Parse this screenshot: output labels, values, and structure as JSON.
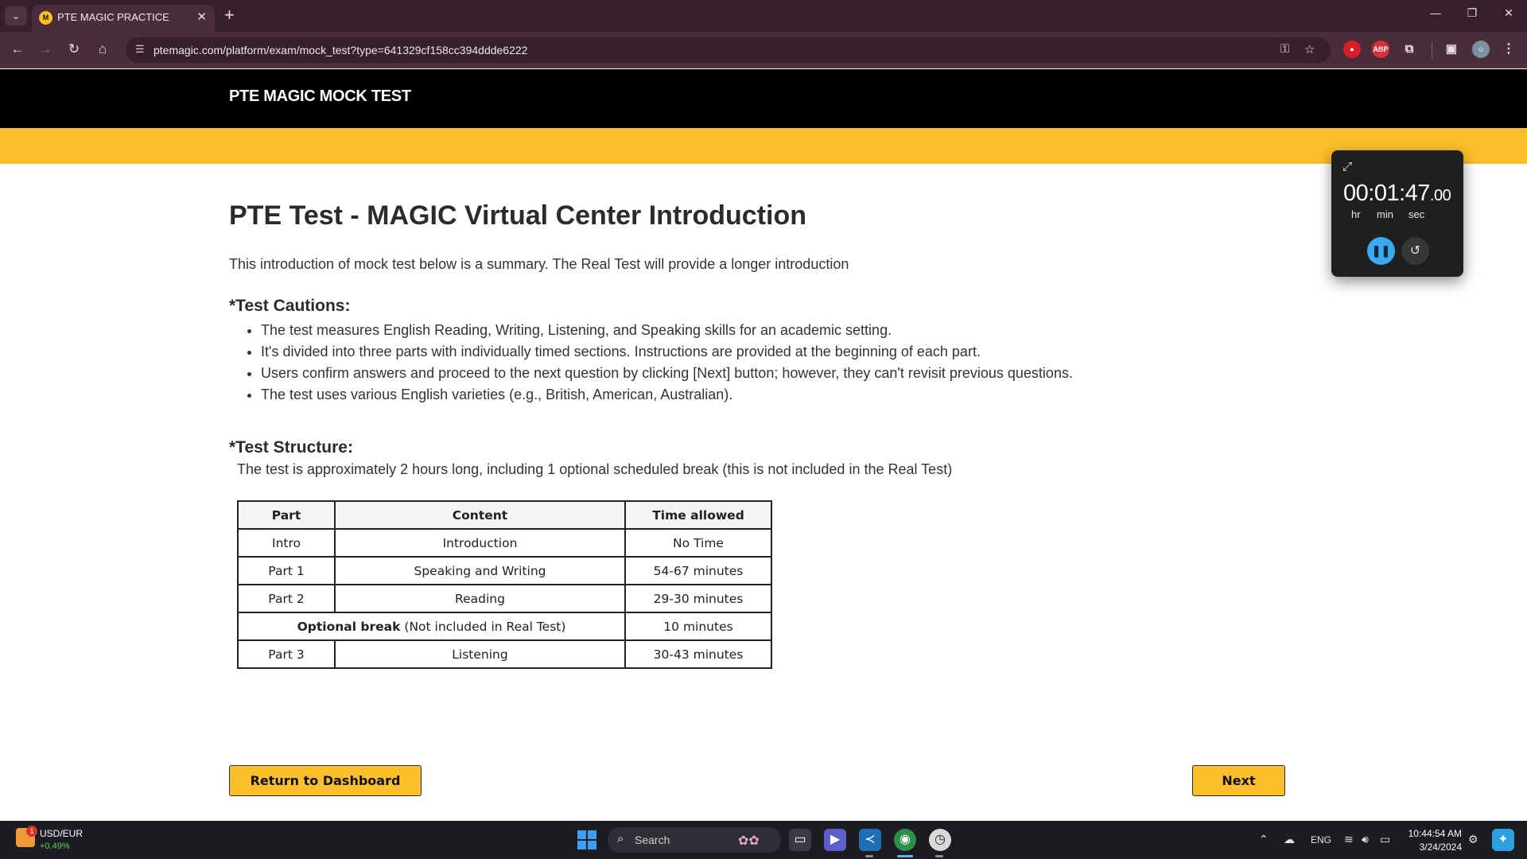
{
  "browser": {
    "tab_title": "PTE MAGIC PRACTICE",
    "tab_favicon_text": "M",
    "new_tab_symbol": "+",
    "close_tab_symbol": "✕",
    "url": "ptemagic.com/platform/exam/mock_test?type=641329cf158cc394ddde6222",
    "extensions": [
      "shield-extension-icon",
      "adblock-icon",
      "puzzle-extensions-icon"
    ],
    "adblock_label": "ABP"
  },
  "header": {
    "logo": "PTE MAGIC MOCK TEST"
  },
  "main": {
    "title": "PTE Test - MAGIC Virtual Center Introduction",
    "intro": "This introduction of mock test below is a summary. The Real Test will provide a longer introduction",
    "cautions_heading": "*Test Cautions:",
    "cautions": [
      "The test measures English Reading, Writing, Listening, and Speaking skills for an academic setting.",
      "It's divided into three parts with individually timed sections. Instructions are provided at the beginning of each part.",
      "Users confirm answers and proceed to the next question by clicking [Next] button; however, they can't revisit previous questions.",
      "The test uses various English varieties (e.g., British, American, Australian)."
    ],
    "structure_heading": "*Test Structure:",
    "structure_desc": "The test is approximately 2 hours long, including 1 optional scheduled break (this is not included in the Real Test)",
    "table": {
      "headers": [
        "Part",
        "Content",
        "Time allowed"
      ],
      "rows": [
        {
          "part": "Intro",
          "content": "Introduction",
          "time": "No Time"
        },
        {
          "part": "Part 1",
          "content": "Speaking and Writing",
          "time": "54-67 minutes"
        },
        {
          "part": "Part 2",
          "content": "Reading",
          "time": "29-30 minutes"
        },
        {
          "part": "Optional break",
          "content": "(Not included in Real Test)",
          "time": "10 minutes"
        },
        {
          "part": "Part 3",
          "content": "Listening",
          "time": "30-43 minutes"
        }
      ]
    }
  },
  "buttons": {
    "return": "Return to Dashboard",
    "next": "Next"
  },
  "stopwatch": {
    "time": "00:01:47",
    "centiseconds": ".00",
    "labels": [
      "hr",
      "min",
      "sec"
    ]
  },
  "taskbar": {
    "widget_title": "USD/EUR",
    "widget_change": "+0.49%",
    "widget_badge": "1",
    "search_placeholder": "Search",
    "language": "ENG",
    "time": "10:44:54 AM",
    "date": "3/24/2024"
  },
  "colors": {
    "accent_yellow": "#fbbf2b",
    "header_black": "#000000",
    "browser_frame": "#4b2c3b",
    "stopwatch_accent": "#3ba9ef"
  }
}
